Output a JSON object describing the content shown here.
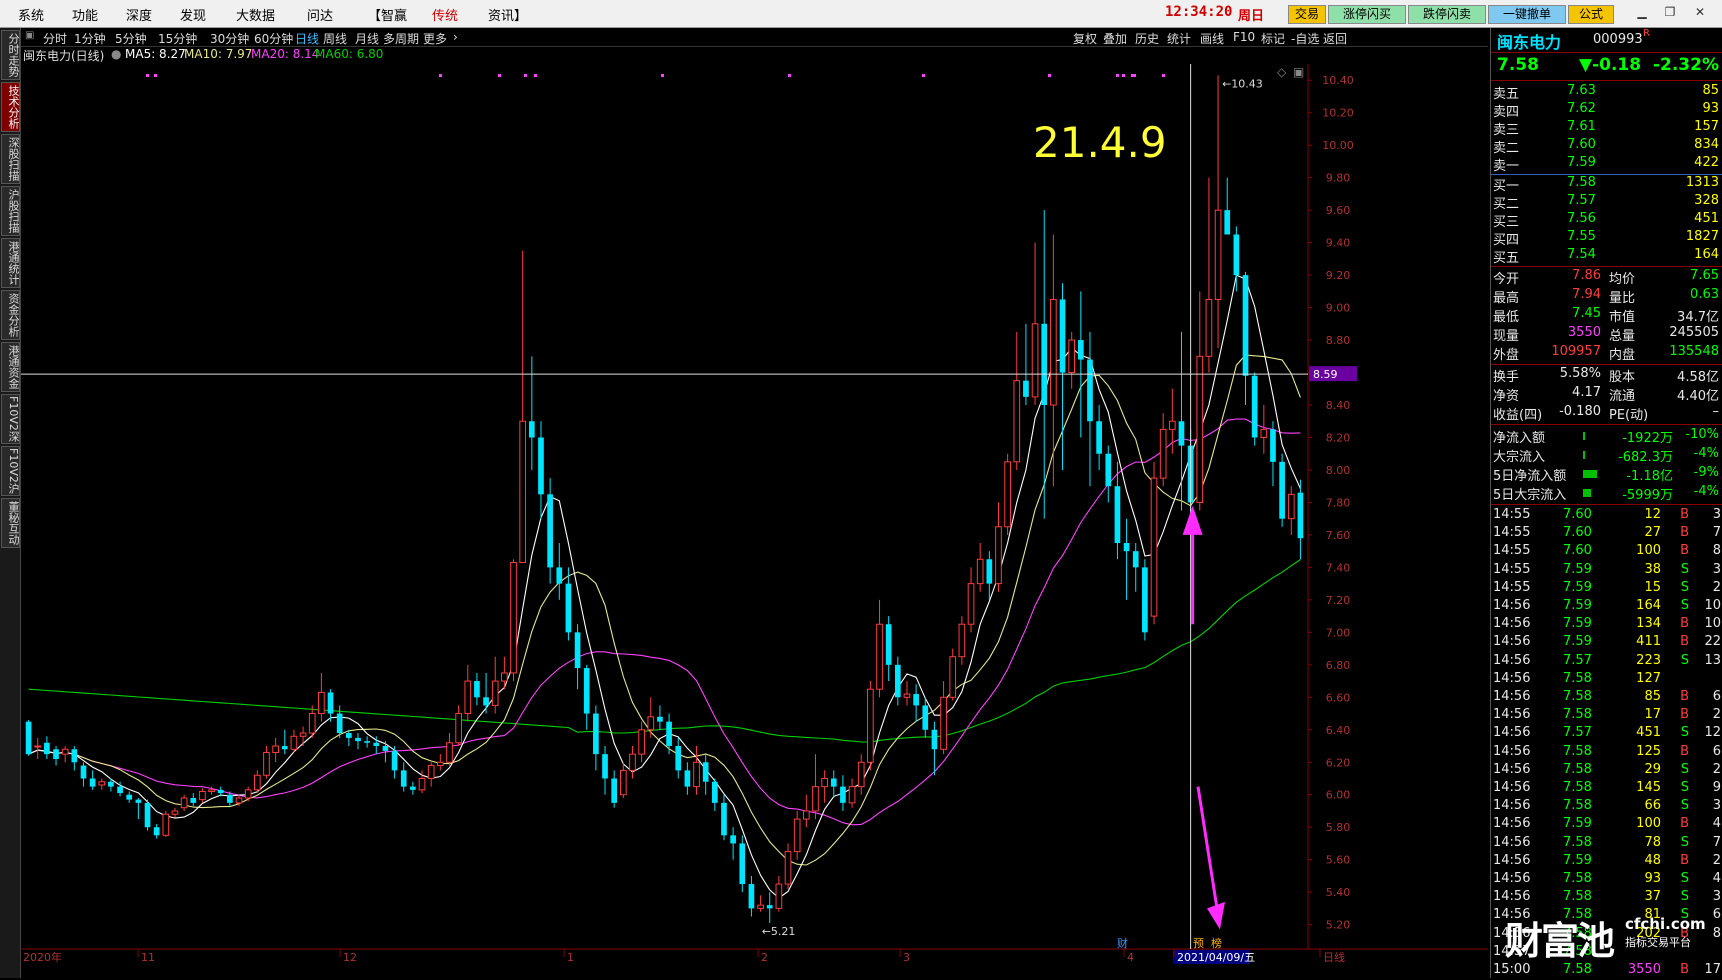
{
  "menu": {
    "items": [
      "系统",
      "功能",
      "深度",
      "发现",
      "大数据",
      "问达",
      "【智赢",
      "传统",
      "资讯】"
    ],
    "clock": "12:34:20",
    "weekday": "周日",
    "buttons": [
      "交易",
      "涨停闪买",
      "跌停闪卖",
      "一键撤单",
      "公式"
    ]
  },
  "left_tabs": [
    "分时走势",
    "技术分析",
    "深股扫描",
    "沪股扫描",
    "港通统计",
    "资金分析",
    "港通资金",
    "F10V2深",
    "F10V2沪",
    "董秘互动"
  ],
  "toolbar": {
    "periods": [
      "分时",
      "1分钟",
      "5分钟",
      "15分钟",
      "30分钟",
      "60分钟",
      "日线",
      "周线",
      "月线",
      "多周期",
      "更多"
    ],
    "active": "日线",
    "right_items": [
      "复权",
      "叠加",
      "历史",
      "统计",
      "画线",
      "F10",
      "标记",
      "-自选",
      "返回"
    ]
  },
  "indicator": {
    "name": "闽东电力(日线)",
    "ma5": "MA5: 8.27",
    "ma10": "MA10: 7.97",
    "ma20": "MA20: 8.14",
    "ma60": "MA60: 6.80"
  },
  "chart_data": {
    "type": "candlestick",
    "ylim": [
      5.05,
      10.5
    ],
    "y_ticks": [
      "10.40",
      "10.20",
      "10.00",
      "9.80",
      "9.60",
      "9.40",
      "9.20",
      "9.00",
      "8.80",
      "8.60",
      "8.40",
      "8.20",
      "8.00",
      "7.80",
      "7.60",
      "7.40",
      "7.20",
      "7.00",
      "6.80",
      "6.60",
      "6.40",
      "6.20",
      "6.00",
      "5.80",
      "5.60",
      "5.40",
      "5.20"
    ],
    "x_labels": [
      "2020年",
      "11",
      "12",
      "1",
      "2",
      "3",
      "4",
      "2021/04/09/五",
      "日线"
    ],
    "crosshair_price": "8.59",
    "annotation": "21.4.9",
    "max_label": "10.43",
    "min_label": "5.21",
    "markers": [
      "财",
      "预",
      "榜"
    ],
    "candles": [
      [
        6.45,
        6.25,
        6.46,
        6.24
      ],
      [
        6.3,
        6.3,
        6.35,
        6.22
      ],
      [
        6.32,
        6.25,
        6.36,
        6.22
      ],
      [
        6.28,
        6.22,
        6.3,
        6.18
      ],
      [
        6.25,
        6.28,
        6.3,
        6.2
      ],
      [
        6.28,
        6.2,
        6.3,
        6.15
      ],
      [
        6.18,
        6.1,
        6.2,
        6.05
      ],
      [
        6.1,
        6.05,
        6.15,
        6.03
      ],
      [
        6.06,
        6.08,
        6.1,
        6.03
      ],
      [
        6.08,
        6.05,
        6.1,
        6.02
      ],
      [
        6.05,
        6.01,
        6.08,
        5.99
      ],
      [
        6.0,
        5.97,
        6.02,
        5.95
      ],
      [
        5.97,
        5.95,
        5.98,
        5.85
      ],
      [
        5.95,
        5.8,
        5.97,
        5.78
      ],
      [
        5.8,
        5.75,
        5.82,
        5.73
      ],
      [
        5.75,
        5.88,
        5.9,
        5.74
      ],
      [
        5.88,
        5.9,
        5.92,
        5.86
      ],
      [
        5.92,
        5.98,
        6.0,
        5.9
      ],
      [
        5.98,
        5.95,
        6.01,
        5.93
      ],
      [
        5.97,
        6.02,
        6.04,
        5.95
      ],
      [
        6.02,
        6.03,
        6.05,
        6.0
      ],
      [
        6.03,
        6.01,
        6.05,
        5.99
      ],
      [
        6.0,
        5.95,
        6.02,
        5.93
      ],
      [
        5.95,
        5.98,
        6.0,
        5.93
      ],
      [
        5.98,
        6.03,
        6.05,
        5.96
      ],
      [
        6.03,
        6.12,
        6.15,
        6.01
      ],
      [
        6.12,
        6.26,
        6.3,
        6.1
      ],
      [
        6.26,
        6.3,
        6.35,
        6.2
      ],
      [
        6.3,
        6.28,
        6.4,
        6.25
      ],
      [
        6.28,
        6.36,
        6.4,
        6.26
      ],
      [
        6.36,
        6.38,
        6.42,
        6.3
      ],
      [
        6.38,
        6.5,
        6.55,
        6.35
      ],
      [
        6.5,
        6.63,
        6.75,
        6.45
      ],
      [
        6.63,
        6.5,
        6.65,
        6.45
      ],
      [
        6.5,
        6.38,
        6.55,
        6.35
      ],
      [
        6.38,
        6.35,
        6.4,
        6.3
      ],
      [
        6.35,
        6.33,
        6.38,
        6.28
      ],
      [
        6.33,
        6.32,
        6.36,
        6.29
      ],
      [
        6.32,
        6.3,
        6.36,
        6.25
      ],
      [
        6.3,
        6.27,
        6.33,
        6.2
      ],
      [
        6.27,
        6.15,
        6.3,
        6.1
      ],
      [
        6.15,
        6.05,
        6.2,
        6.02
      ],
      [
        6.05,
        6.03,
        6.08,
        6.0
      ],
      [
        6.03,
        6.1,
        6.15,
        6.01
      ],
      [
        6.1,
        6.18,
        6.2,
        6.05
      ],
      [
        6.18,
        6.2,
        6.25,
        6.15
      ],
      [
        6.2,
        6.32,
        6.38,
        6.18
      ],
      [
        6.32,
        6.5,
        6.55,
        6.3
      ],
      [
        6.5,
        6.7,
        6.8,
        6.45
      ],
      [
        6.7,
        6.6,
        6.75,
        6.55
      ],
      [
        6.6,
        6.55,
        6.75,
        6.5
      ],
      [
        6.55,
        6.7,
        6.85,
        6.5
      ],
      [
        6.7,
        6.75,
        6.85,
        6.65
      ],
      [
        6.75,
        7.43,
        7.45,
        6.7
      ],
      [
        7.43,
        8.3,
        9.35,
        8.25
      ],
      [
        8.3,
        8.2,
        8.7,
        8.0
      ],
      [
        8.2,
        7.85,
        8.3,
        7.7
      ],
      [
        7.85,
        7.4,
        7.95,
        7.3
      ],
      [
        7.4,
        7.3,
        7.55,
        7.2
      ],
      [
        7.3,
        7.0,
        7.4,
        6.95
      ],
      [
        7.0,
        6.78,
        7.05,
        6.65
      ],
      [
        6.78,
        6.5,
        6.8,
        6.4
      ],
      [
        6.5,
        6.25,
        6.55,
        6.15
      ],
      [
        6.25,
        6.1,
        6.3,
        6.0
      ],
      [
        6.1,
        5.95,
        6.15,
        5.92
      ],
      [
        6.0,
        6.15,
        6.2,
        5.98
      ],
      [
        6.15,
        6.25,
        6.3,
        6.1
      ],
      [
        6.25,
        6.4,
        6.45,
        6.2
      ],
      [
        6.4,
        6.48,
        6.6,
        6.35
      ],
      [
        6.48,
        6.45,
        6.55,
        6.4
      ],
      [
        6.45,
        6.3,
        6.5,
        6.25
      ],
      [
        6.3,
        6.15,
        6.35,
        6.1
      ],
      [
        6.15,
        6.05,
        6.2,
        6.0
      ],
      [
        6.05,
        6.2,
        6.3,
        6.0
      ],
      [
        6.2,
        6.08,
        6.25,
        6.0
      ],
      [
        6.08,
        5.95,
        6.1,
        5.9
      ],
      [
        5.95,
        5.75,
        6.0,
        5.72
      ],
      [
        5.75,
        5.7,
        5.8,
        5.6
      ],
      [
        5.7,
        5.45,
        5.75,
        5.4
      ],
      [
        5.45,
        5.3,
        5.5,
        5.25
      ],
      [
        5.3,
        5.32,
        5.38,
        5.28
      ],
      [
        5.32,
        5.3,
        5.4,
        5.21
      ],
      [
        5.3,
        5.45,
        5.5,
        5.28
      ],
      [
        5.45,
        5.65,
        5.7,
        5.42
      ],
      [
        5.65,
        5.85,
        5.9,
        5.6
      ],
      [
        5.85,
        5.9,
        6.0,
        5.8
      ],
      [
        5.9,
        6.05,
        6.25,
        5.85
      ],
      [
        6.05,
        6.1,
        6.15,
        5.95
      ],
      [
        6.1,
        6.05,
        6.15,
        5.98
      ],
      [
        6.05,
        5.95,
        6.12,
        5.9
      ],
      [
        5.95,
        6.05,
        6.1,
        5.92
      ],
      [
        6.05,
        6.2,
        6.25,
        6.0
      ],
      [
        6.2,
        6.65,
        6.7,
        6.15
      ],
      [
        6.65,
        7.05,
        7.2,
        6.6
      ],
      [
        7.05,
        6.8,
        7.1,
        6.7
      ],
      [
        6.8,
        6.6,
        6.85,
        6.55
      ],
      [
        6.6,
        6.62,
        6.7,
        6.55
      ],
      [
        6.62,
        6.55,
        6.68,
        6.45
      ],
      [
        6.55,
        6.4,
        6.6,
        6.35
      ],
      [
        6.4,
        6.28,
        6.45,
        6.12
      ],
      [
        6.28,
        6.6,
        6.7,
        6.25
      ],
      [
        6.6,
        6.85,
        6.9,
        6.58
      ],
      [
        6.85,
        7.05,
        7.1,
        6.8
      ],
      [
        7.05,
        7.3,
        7.4,
        7.0
      ],
      [
        7.3,
        7.45,
        7.55,
        7.25
      ],
      [
        7.45,
        7.3,
        7.5,
        7.2
      ],
      [
        7.3,
        7.65,
        7.8,
        7.25
      ],
      [
        7.65,
        8.05,
        8.1,
        7.6
      ],
      [
        8.05,
        8.55,
        8.85,
        8.0
      ],
      [
        8.55,
        8.45,
        8.9,
        8.4
      ],
      [
        8.45,
        8.9,
        9.4,
        8.4
      ],
      [
        8.9,
        8.4,
        9.6,
        7.7
      ],
      [
        8.4,
        9.05,
        9.45,
        7.9
      ],
      [
        9.05,
        8.6,
        9.15,
        8.0
      ],
      [
        8.6,
        8.8,
        8.85,
        8.5
      ],
      [
        8.8,
        8.68,
        9.1,
        8.2
      ],
      [
        8.68,
        8.3,
        8.85,
        7.9
      ],
      [
        8.3,
        8.1,
        8.4,
        8.0
      ],
      [
        8.1,
        7.9,
        8.15,
        7.8
      ],
      [
        7.9,
        7.55,
        8.05,
        7.45
      ],
      [
        7.55,
        7.5,
        7.7,
        7.2
      ],
      [
        7.5,
        7.4,
        7.55,
        7.25
      ],
      [
        7.4,
        7.0,
        7.45,
        6.95
      ],
      [
        7.1,
        7.95,
        8.05,
        7.05
      ],
      [
        7.95,
        8.25,
        8.35,
        7.9
      ],
      [
        8.25,
        8.3,
        8.5,
        8.1
      ],
      [
        8.3,
        8.15,
        8.85,
        7.75
      ],
      [
        8.15,
        7.8,
        8.25,
        7.6
      ],
      [
        7.8,
        8.7,
        9.1,
        7.75
      ],
      [
        8.7,
        9.05,
        9.8,
        8.6
      ],
      [
        9.05,
        9.6,
        10.43,
        8.75
      ],
      [
        9.6,
        9.45,
        9.8,
        9.45
      ],
      [
        9.45,
        9.2,
        9.5,
        9.1
      ],
      [
        9.2,
        8.58,
        9.22,
        8.4
      ],
      [
        8.58,
        8.2,
        8.6,
        8.15
      ],
      [
        8.2,
        8.25,
        8.4,
        8.1
      ],
      [
        8.25,
        8.05,
        8.3,
        7.9
      ],
      [
        8.05,
        7.7,
        8.1,
        7.65
      ],
      [
        7.7,
        7.85,
        7.9,
        7.6
      ],
      [
        7.86,
        7.58,
        7.94,
        7.45
      ]
    ]
  },
  "quote": {
    "name": "闽东电力",
    "code": "000993",
    "badge": "R",
    "price": "7.58",
    "change": "▼-0.18",
    "pct": "-2.32%",
    "asks": [
      {
        "label": "卖五",
        "price": "7.63",
        "vol": "85"
      },
      {
        "label": "卖四",
        "price": "7.62",
        "vol": "93"
      },
      {
        "label": "卖三",
        "price": "7.61",
        "vol": "157"
      },
      {
        "label": "卖二",
        "price": "7.60",
        "vol": "834"
      },
      {
        "label": "卖一",
        "price": "7.59",
        "vol": "422"
      }
    ],
    "bids": [
      {
        "label": "买一",
        "price": "7.58",
        "vol": "1313"
      },
      {
        "label": "买二",
        "price": "7.57",
        "vol": "328"
      },
      {
        "label": "买三",
        "price": "7.56",
        "vol": "451"
      },
      {
        "label": "买四",
        "price": "7.55",
        "vol": "1827"
      },
      {
        "label": "买五",
        "price": "7.54",
        "vol": "164"
      }
    ],
    "stats": [
      {
        "l1": "今开",
        "v1": "7.86",
        "c1": "red2",
        "l2": "均价",
        "v2": "7.65",
        "c2": "grn"
      },
      {
        "l1": "最高",
        "v1": "7.94",
        "c1": "red2",
        "l2": "量比",
        "v2": "0.63",
        "c2": "grn"
      },
      {
        "l1": "最低",
        "v1": "7.45",
        "c1": "grn",
        "l2": "市值",
        "v2": "34.7亿",
        "c2": "wht"
      },
      {
        "l1": "现量",
        "v1": "3550",
        "c1": "mag",
        "l2": "总量",
        "v2": "245505",
        "c2": "wht"
      },
      {
        "l1": "外盘",
        "v1": "109957",
        "c1": "red2",
        "l2": "内盘",
        "v2": "135548",
        "c2": "grn"
      }
    ],
    "stats2": [
      {
        "l1": "换手",
        "v1": "5.58%",
        "l2": "股本",
        "v2": "4.58亿"
      },
      {
        "l1": "净资",
        "v1": "4.17",
        "l2": "流通",
        "v2": "4.40亿"
      },
      {
        "l1": "收益(四)",
        "v1": "-0.180",
        "l2": "PE(动)",
        "v2": "–"
      }
    ],
    "flows": [
      {
        "label": "净流入额",
        "value": "-1922万",
        "pct": "-10%"
      },
      {
        "label": "大宗流入",
        "value": "-682.3万",
        "pct": "-4%"
      },
      {
        "label": "5日净流入额",
        "value": "-1.18亿",
        "pct": "-9%"
      },
      {
        "label": "5日大宗流入",
        "value": "-5999万",
        "pct": "-4%"
      }
    ],
    "ticks": [
      [
        "14:55",
        "7.60",
        "12",
        "B",
        "3"
      ],
      [
        "14:55",
        "7.60",
        "27",
        "B",
        "7"
      ],
      [
        "14:55",
        "7.60",
        "100",
        "B",
        "8"
      ],
      [
        "14:55",
        "7.59",
        "38",
        "S",
        "3"
      ],
      [
        "14:55",
        "7.59",
        "15",
        "S",
        "2"
      ],
      [
        "14:56",
        "7.59",
        "164",
        "S",
        "10"
      ],
      [
        "14:56",
        "7.59",
        "134",
        "B",
        "10"
      ],
      [
        "14:56",
        "7.59",
        "411",
        "B",
        "22"
      ],
      [
        "14:56",
        "7.57",
        "223",
        "S",
        "13"
      ],
      [
        "14:56",
        "7.58",
        "127",
        "",
        ""
      ],
      [
        "14:56",
        "7.58",
        "85",
        "B",
        "6"
      ],
      [
        "14:56",
        "7.58",
        "17",
        "B",
        "2"
      ],
      [
        "14:56",
        "7.57",
        "451",
        "S",
        "12"
      ],
      [
        "14:56",
        "7.58",
        "125",
        "B",
        "6"
      ],
      [
        "14:56",
        "7.58",
        "29",
        "S",
        "2"
      ],
      [
        "14:56",
        "7.58",
        "145",
        "S",
        "9"
      ],
      [
        "14:56",
        "7.58",
        "66",
        "S",
        "3"
      ],
      [
        "14:56",
        "7.59",
        "100",
        "B",
        "4"
      ],
      [
        "14:56",
        "7.58",
        "78",
        "S",
        "7"
      ],
      [
        "14:56",
        "7.59",
        "48",
        "B",
        "2"
      ],
      [
        "14:56",
        "7.58",
        "93",
        "S",
        "4"
      ],
      [
        "14:56",
        "7.58",
        "37",
        "S",
        "3"
      ],
      [
        "14:56",
        "7.58",
        "81",
        "S",
        "6"
      ],
      [
        "14:56",
        "7.58",
        "202",
        "B",
        "8"
      ],
      [
        "14:57",
        "7.58",
        "",
        "",
        ""
      ],
      [
        "15:00",
        "7.58",
        "3550",
        "B",
        "17"
      ]
    ]
  },
  "watermark": {
    "brand": "财富池",
    "site": "cfchi.com",
    "slogan": "指标交易平台"
  },
  "colors": {
    "up": "#ff3c3c",
    "down": "#00e5ff",
    "ma5": "#ffffff",
    "ma10": "#e6e68c",
    "ma20": "#ff40ff",
    "ma60": "#00d000",
    "annotation": "#ffff33",
    "arrow": "#ff2bff"
  }
}
